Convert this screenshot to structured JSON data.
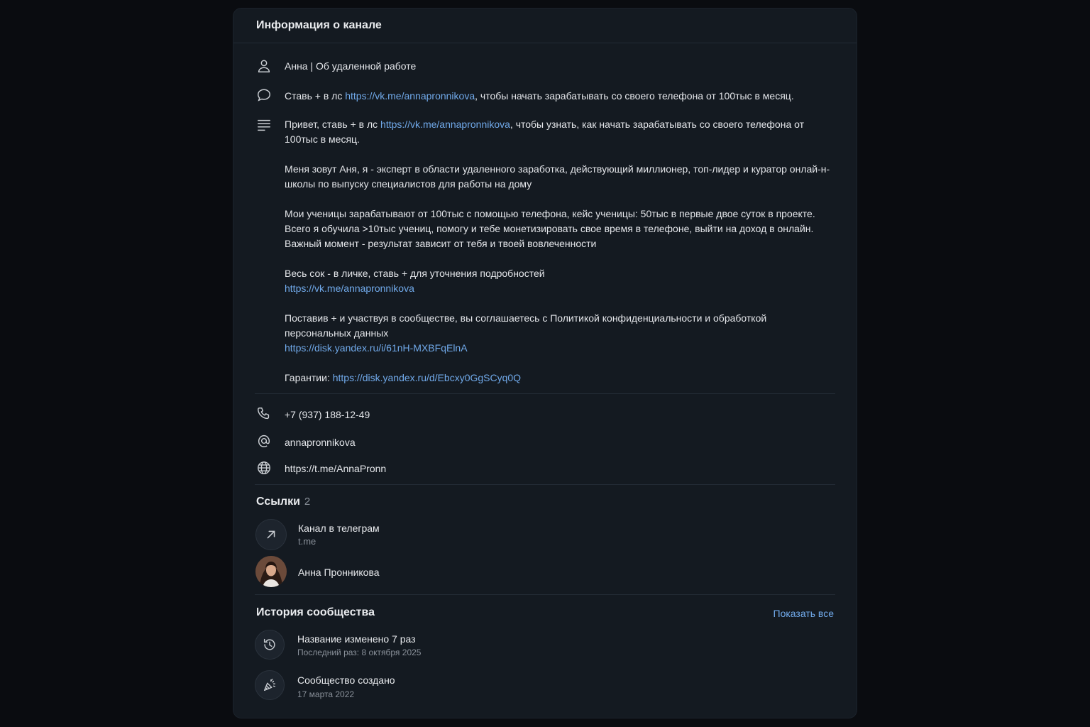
{
  "header": {
    "title": "Информация о канале"
  },
  "name_row": {
    "text": "Анна | Об удаленной работе"
  },
  "short_desc": {
    "prefix": "Ставь + в лс ",
    "link": "https://vk.me/annapronnikova",
    "suffix": ", чтобы начать зарабатывать со своего телефона от 100тыс в месяц."
  },
  "full_desc": {
    "p1_prefix": "Привет, ставь + в лс ",
    "p1_link": "https://vk.me/annapronnikova",
    "p1_suffix": ", чтобы узнать, как начать зарабатывать со своего телефона от 100тыс в месяц.",
    "p2": "Меня зовут Аня, я - эксперт в области удаленного заработка, действующий миллионер, топ-лидер и куратор онлай-н-школы по выпуску специалистов для работы на дому",
    "p3_l1": "Мои ученицы зарабатывают от 100тыс с помощью телефона, кейс ученицы: 50тыс в первые двое суток в проекте.",
    "p3_l2": "Всего я обучила >10тыс учениц, помогу и тебе монетизировать свое время в телефоне, выйти на доход в онлайн.",
    "p3_l3": "Важный момент - результат зависит от тебя и твоей вовлеченности",
    "p4_text": "Весь сок - в личке, ставь + для уточнения подробностей",
    "p4_link": "https://vk.me/annapronnikova",
    "p5_text": "Поставив + и участвуя в сообществе, вы соглашаетесь с Политикой конфиденциальности и обработкой персональных данных",
    "p5_link": "https://disk.yandex.ru/i/61nH-MXBFqElnA",
    "p6_prefix": "Гарантии: ",
    "p6_link": "https://disk.yandex.ru/d/Ebcxy0GgSCyq0Q"
  },
  "contacts": {
    "phone": "+7 (937) 188-12-49",
    "handle": "annapronnikova",
    "website": "https://t.me/AnnaPronn"
  },
  "links_section": {
    "title": "Ссылки",
    "count": "2",
    "items": [
      {
        "title": "Канал в телеграм",
        "subtitle": "t.me",
        "icon": "arrow-up-right-icon"
      },
      {
        "title": "Анна Пронникова",
        "icon": "avatar"
      }
    ]
  },
  "history": {
    "title": "История сообщества",
    "show_all": "Показать все",
    "items": [
      {
        "title": "Название изменено 7 раз",
        "subtitle": "Последний раз: 8 октября 2025",
        "icon": "history-icon"
      },
      {
        "title": "Сообщество создано",
        "subtitle": "17 марта 2022",
        "icon": "party-popper-icon"
      }
    ]
  },
  "colors": {
    "background": "#0a0c10",
    "panel": "#141a21",
    "link": "#71aaeb",
    "text": "#e4e6ea",
    "muted": "#8a919a"
  }
}
